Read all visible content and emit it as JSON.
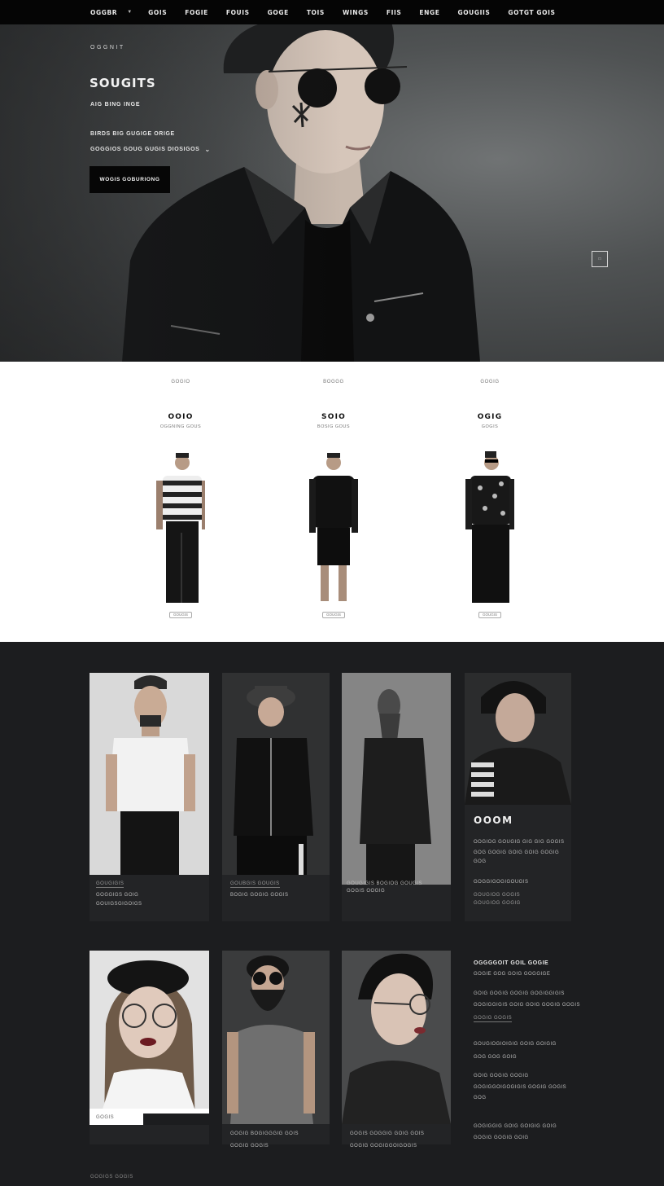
{
  "nav": {
    "items": [
      "OGGBR",
      "GOIS",
      "FOGIE",
      "FOUIS",
      "GOGE",
      "TOIS",
      "WINGS",
      "FIIS",
      "ENGE",
      "GOUGIIS",
      "GOTGT GOIS"
    ]
  },
  "hero": {
    "eyebrow": "OGGNIT",
    "title": "SOUGITS",
    "subtitle": "AIG BING INGE",
    "line1": "BIRDS BIG GUGIGE ORIGE",
    "line2": "GOGGIOS GOUG GUGIS DIOSIGOS",
    "button": "WOGIS GOBURIONG"
  },
  "products": [
    {
      "category": "GOGIO",
      "price": "OOIO",
      "name": "OGGNING GOUS",
      "link": "GOUGIS"
    },
    {
      "category": "BOGGG",
      "price": "SOIO",
      "name": "BOSIG GOUS",
      "link": "GOUGIS"
    },
    {
      "category": "GOGIG",
      "price": "OGIG",
      "name": "GOGIS",
      "link": "GOUGIS"
    }
  ],
  "grid": {
    "card1": {
      "cap1": "GOUGIGIS",
      "cap2": "GOGGIGS GOIG",
      "cap3": "GOUIGSGIGOIGS"
    },
    "card2": {
      "cap1": "GOUBGIS GOUGIS",
      "cap2": "BOGIG GOGIG GOGIS"
    },
    "card3": {
      "cap1": "GOUGIGIS BOGIOG GOUGIS",
      "cap2": "GOGIS OOGIG"
    },
    "card4": {
      "title": "OOOM",
      "l1": "OOGIOG GOUGIG GIG GIG GOGIS",
      "l2": "GOG GOGIG GOIG GOIG GOGIG",
      "l3": "GOG",
      "l4": "GOGGIGOGIGOUGIS",
      "l5": "GOUGIOG GOGIS",
      "l6": "GOUGIOG GOGIG"
    },
    "card5": {
      "cap1": "GOGIS"
    },
    "card6": {
      "cap1": "GOGIG BOGIGGGIG GOIS",
      "cap2": "GOGIG GOGIS"
    },
    "card7": {
      "cap1": "GOGIS GOGGIG GOIG GOIS",
      "cap2": "GOGIG GOGIGGOIGOGIS"
    },
    "side": {
      "title": "OGGGGOIT GOIL GOGIE",
      "l1": "GOGIE GOG GOIG GOGGIGE",
      "l2": "GOIG GOGIG GOGIG GOGIGGIGIS",
      "l3": "GOGIGGIGIS GOIG GOIG GOGIG GOGIS",
      "l4": "GOGIG GOGIS",
      "l5": "GOUGIOGIOIGIG GOIG GOIGIG",
      "l6": "GOG GOG GOIG",
      "l7": "GOIG GOGIG GOGIG",
      "l8": "GOGIGGOIGOGIGIS GOGIG GOGIS",
      "l9": "GOG",
      "l10": "GOGIGGIG GOIG GOIGIG GOIG",
      "l11": "GOGIG GOGIG GOIG"
    },
    "footer": "GOGIGS GOGIS"
  },
  "colors": {
    "nav_bg": "#050505",
    "hero_bg": "#4f5253",
    "products_bg": "#ffffff",
    "grid_bg": "#1c1d1f"
  }
}
